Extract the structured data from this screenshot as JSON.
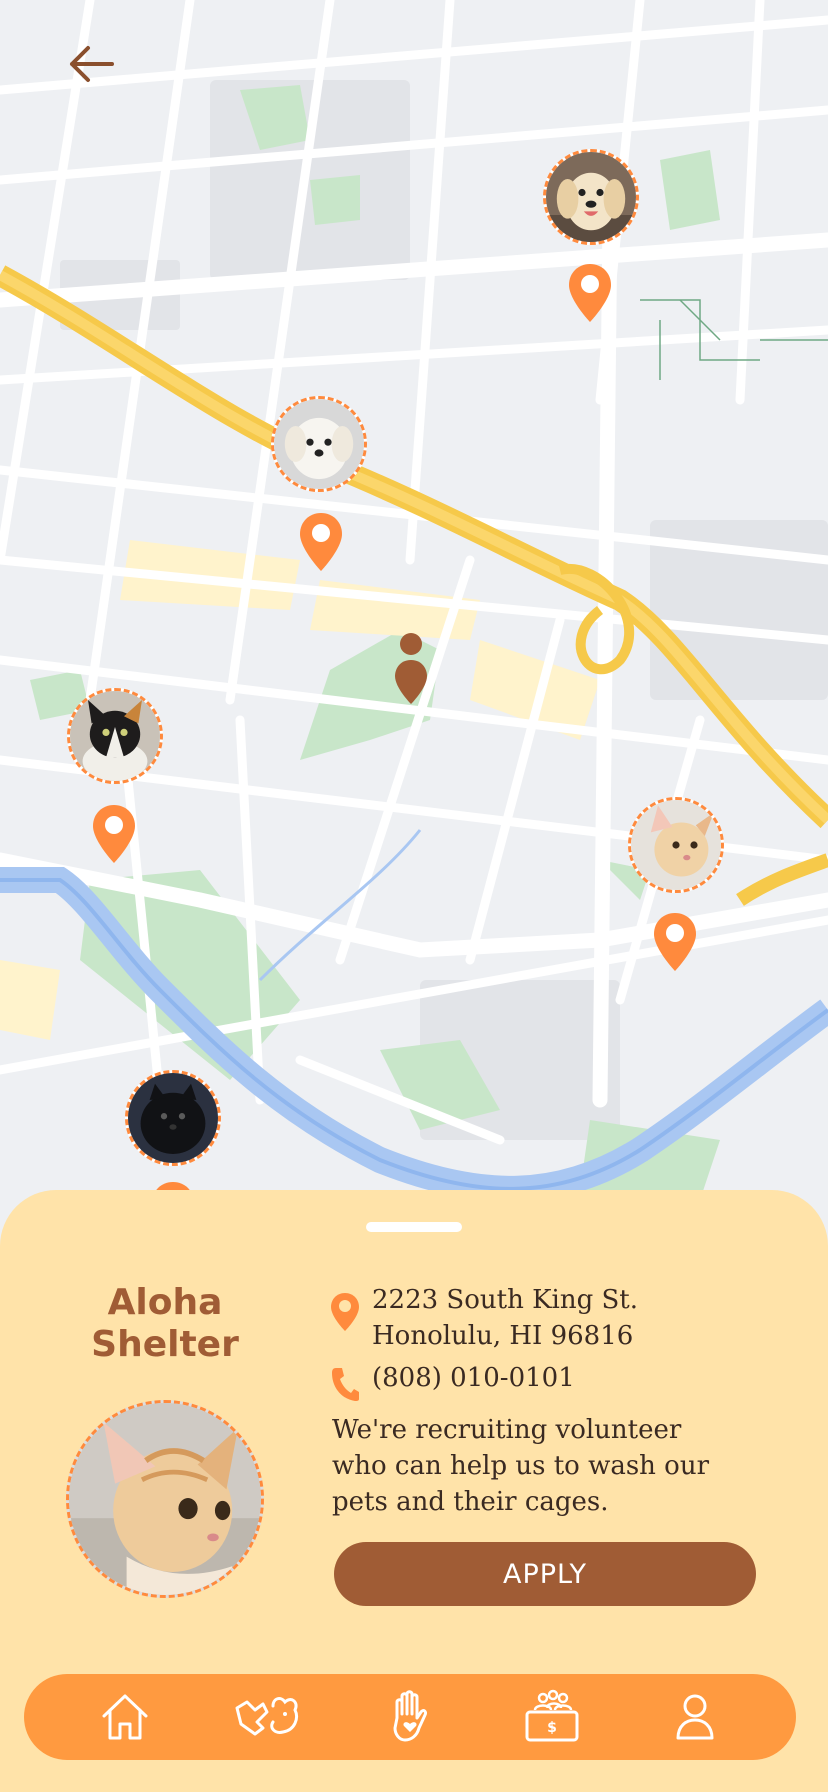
{
  "map": {
    "back_icon": "arrow-left-icon",
    "pin_color": "#ff8a3d",
    "user_location_color": "#a05c35",
    "pets": [
      {
        "name": "dog"
      },
      {
        "name": "maltese"
      },
      {
        "name": "calico-kitten"
      },
      {
        "name": "tabby-cat"
      },
      {
        "name": "black-pomeranian"
      }
    ]
  },
  "shelter": {
    "name": "Aloha Shelter",
    "address_line1": "2223 South King St.",
    "address_line2": "Honolulu, HI 96816",
    "phone": "(808) 010-0101",
    "description": "We're recruiting volunteer who can help us to wash our pets and their cages.",
    "apply_label": "APPLY",
    "background": "#ffe3a9",
    "accent": "#a05c35"
  },
  "nav": {
    "background": "#ff9a40",
    "items": [
      {
        "icon": "home-icon"
      },
      {
        "icon": "pet-care-icon"
      },
      {
        "icon": "volunteer-hand-icon"
      },
      {
        "icon": "donate-icon"
      },
      {
        "icon": "profile-icon"
      }
    ]
  }
}
